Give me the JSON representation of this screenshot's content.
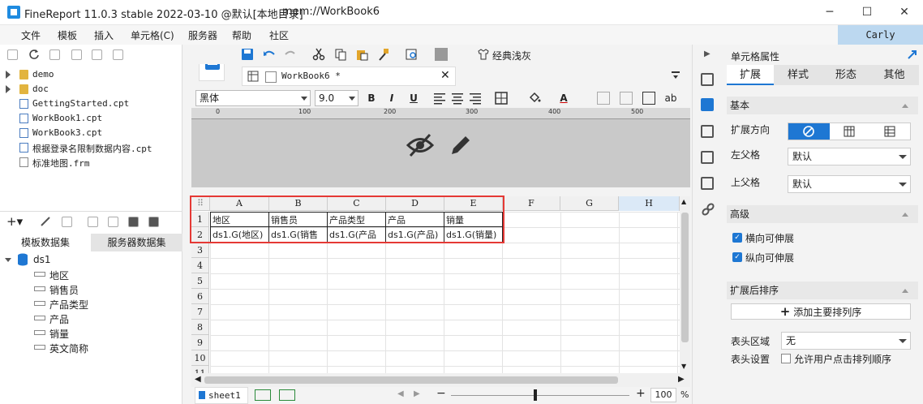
{
  "window": {
    "title": "FineReport 11.0.3 stable 2022-03-10 @默认[本地目录]",
    "path": "mem://WorkBook6",
    "minimize": "─",
    "maximize": "☐",
    "close": "✕"
  },
  "menu": [
    "文件",
    "模板",
    "插入",
    "单元格(C)",
    "服务器",
    "帮助",
    "社区"
  ],
  "user": "Carly",
  "file_tree": [
    {
      "name": "demo",
      "type": "folder"
    },
    {
      "name": "doc",
      "type": "folder"
    },
    {
      "name": "GettingStarted.cpt",
      "type": "file"
    },
    {
      "name": "WorkBook1.cpt",
      "type": "file"
    },
    {
      "name": "WorkBook3.cpt",
      "type": "file"
    },
    {
      "name": "根据登录名限制数据内容.cpt",
      "type": "file"
    },
    {
      "name": "标准地图.frm",
      "type": "file"
    }
  ],
  "dataset_tabs": [
    "模板数据集",
    "服务器数据集"
  ],
  "dataset": {
    "name": "ds1",
    "fields": [
      "地区",
      "销售员",
      "产品类型",
      "产品",
      "销量",
      "英文简称"
    ]
  },
  "toolbar": {
    "theme_label": "经典浅灰"
  },
  "doc_tab": "WorkBook6 *",
  "format": {
    "font": "黑体",
    "size": "9.0",
    "bold": "B",
    "italic": "I",
    "underline": "U",
    "text_color_letter": "A",
    "ab": "ab"
  },
  "ruler": [
    "0",
    "100",
    "200",
    "300",
    "400",
    "500"
  ],
  "columns": [
    "A",
    "B",
    "C",
    "D",
    "E",
    "F",
    "G",
    "H"
  ],
  "rows": [
    "1",
    "2",
    "3",
    "4",
    "5",
    "6",
    "7",
    "8",
    "9",
    "10",
    "11"
  ],
  "cells": {
    "r1": [
      "地区",
      "销售员",
      "产品类型",
      "产品",
      "销量"
    ],
    "r2": [
      "ds1.G(地区)",
      "ds1.G(销售",
      "ds1.G(产品",
      "ds1.G(产品)",
      "ds1.G(销量)"
    ]
  },
  "sheet_tab": "sheet1",
  "zoom": "100",
  "zoom_unit": "%",
  "zoom_minus": "−",
  "zoom_plus": "+",
  "props": {
    "title": "单元格属性",
    "tabs": [
      "扩展",
      "样式",
      "形态",
      "其他"
    ],
    "basic": "基本",
    "expand_dir": "扩展方向",
    "left_parent": "左父格",
    "left_parent_value": "默认",
    "top_parent": "上父格",
    "top_parent_value": "默认",
    "advanced": "高级",
    "h_stretch": "横向可伸展",
    "v_stretch": "纵向可伸展",
    "sort": "扩展后排序",
    "add_sort": "添加主要排列序",
    "header_area": "表头区域",
    "header_area_value": "无",
    "header_setting": "表头设置",
    "allow_sort": "允许用户点击排列顺序"
  }
}
